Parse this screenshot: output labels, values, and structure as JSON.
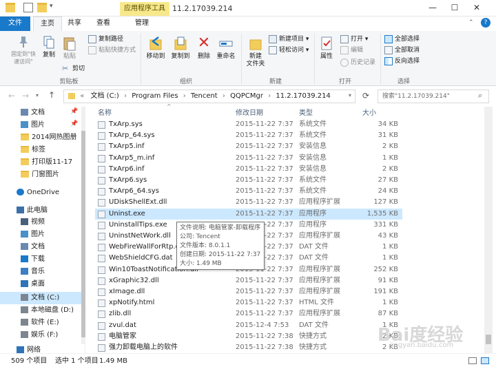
{
  "window": {
    "title": "11.2.17039.214",
    "context_tab": "应用程序工具",
    "controls": {
      "minimize": "—",
      "maximize": "☐",
      "close": "✕"
    }
  },
  "ribbon_tabs": [
    "文件",
    "主页",
    "共享",
    "查看",
    "管理"
  ],
  "ribbon": {
    "clipboard": {
      "pin": "固定到\"快\n速访问\"",
      "copy": "复制",
      "paste": "粘贴",
      "copy_path": "复制路径",
      "paste_shortcut": "粘贴快捷方式",
      "cut": "剪切",
      "label": "剪贴板"
    },
    "organize": {
      "move_to": "移动到",
      "copy_to": "复制到",
      "delete": "删除",
      "rename": "重命名",
      "label": "组织"
    },
    "new": {
      "new_folder": "新建\n文件夹",
      "new_item": "新建项目",
      "easy_access": "轻松访问",
      "label": "新建"
    },
    "open": {
      "properties": "属性",
      "open": "打开",
      "edit": "编辑",
      "history": "历史记录",
      "label": "打开"
    },
    "select": {
      "select_all": "全部选择",
      "select_none": "全部取消",
      "invert": "反向选择",
      "label": "选择"
    }
  },
  "address": {
    "crumbs": [
      "文档 (C:)",
      "Program Files",
      "Tencent",
      "QQPCMgr",
      "11.2.17039.214"
    ],
    "search_placeholder": "搜索\"11.2.17039.214\""
  },
  "nav": [
    {
      "label": "文档",
      "kind": "doc"
    },
    {
      "label": "图片",
      "kind": "pic"
    },
    {
      "label": "2014网热图册",
      "kind": "folder"
    },
    {
      "label": "标签",
      "kind": "folder"
    },
    {
      "label": "打印版11-17",
      "kind": "folder"
    },
    {
      "label": "门窗图片",
      "kind": "folder"
    },
    {
      "label": "OneDrive",
      "kind": "cloud"
    },
    {
      "label": "此电脑",
      "kind": "pc"
    },
    {
      "label": "视频",
      "kind": "video"
    },
    {
      "label": "图片",
      "kind": "pic"
    },
    {
      "label": "文档",
      "kind": "doc"
    },
    {
      "label": "下载",
      "kind": "down"
    },
    {
      "label": "音乐",
      "kind": "music"
    },
    {
      "label": "桌面",
      "kind": "desk"
    },
    {
      "label": "文档 (C:)",
      "kind": "drive"
    },
    {
      "label": "本地磁盘 (D:)",
      "kind": "drive"
    },
    {
      "label": "软件 (E:)",
      "kind": "drive"
    },
    {
      "label": "娱乐 (F:)",
      "kind": "drive"
    },
    {
      "label": "网络",
      "kind": "net"
    }
  ],
  "columns": {
    "name": "名称",
    "date": "修改日期",
    "type": "类型",
    "size": "大小"
  },
  "files": [
    {
      "name": "TxArp.sys",
      "date": "2015-11-22 7:37",
      "type": "系统文件",
      "size": "34 KB"
    },
    {
      "name": "TxArp_64.sys",
      "date": "2015-11-22 7:37",
      "type": "系统文件",
      "size": "31 KB"
    },
    {
      "name": "TxArp5.inf",
      "date": "2015-11-22 7:37",
      "type": "安装信息",
      "size": "2 KB"
    },
    {
      "name": "TxArp5_m.inf",
      "date": "2015-11-22 7:37",
      "type": "安装信息",
      "size": "1 KB"
    },
    {
      "name": "TxArp6.inf",
      "date": "2015-11-22 7:37",
      "type": "安装信息",
      "size": "2 KB"
    },
    {
      "name": "TxArp6.sys",
      "date": "2015-11-22 7:37",
      "type": "系统文件",
      "size": "27 KB"
    },
    {
      "name": "TxArp6_64.sys",
      "date": "2015-11-22 7:37",
      "type": "系统文件",
      "size": "24 KB"
    },
    {
      "name": "UDiskShellExt.dll",
      "date": "2015-11-22 7:37",
      "type": "应用程序扩展",
      "size": "127 KB"
    },
    {
      "name": "Uninst.exe",
      "date": "2015-11-22 7:37",
      "type": "应用程序",
      "size": "1,535 KB",
      "selected": true
    },
    {
      "name": "UninstallTips.exe",
      "date": "2015-11-22 7:37",
      "type": "应用程序",
      "size": "331 KB"
    },
    {
      "name": "UninstNetWork.dll",
      "date": "2015-11-22 7:37",
      "type": "应用程序扩展",
      "size": "43 KB"
    },
    {
      "name": "WebFireWallForRtp.dat",
      "date": "2015-11-22 7:37",
      "type": "DAT 文件",
      "size": "1 KB"
    },
    {
      "name": "WebShieldCFG.dat",
      "date": "2015-11-22 7:37",
      "type": "DAT 文件",
      "size": "1 KB"
    },
    {
      "name": "Win10ToastNotification.dll",
      "date": "2015-11-22 7:37",
      "type": "应用程序扩展",
      "size": "252 KB"
    },
    {
      "name": "xGraphic32.dll",
      "date": "2015-11-22 7:37",
      "type": "应用程序扩展",
      "size": "91 KB"
    },
    {
      "name": "xImage.dll",
      "date": "2015-11-22 7:37",
      "type": "应用程序扩展",
      "size": "191 KB"
    },
    {
      "name": "xpNotify.html",
      "date": "2015-11-22 7:37",
      "type": "HTML 文件",
      "size": "1 KB"
    },
    {
      "name": "zlib.dll",
      "date": "2015-11-22 7:37",
      "type": "应用程序扩展",
      "size": "87 KB"
    },
    {
      "name": "zvul.dat",
      "date": "2015-12-4 7:53",
      "type": "DAT 文件",
      "size": "1 KB"
    },
    {
      "name": "电脑管家",
      "date": "2015-11-22 7:38",
      "type": "快捷方式",
      "size": "2 KB"
    },
    {
      "name": "强力卸载电脑上的软件",
      "date": "2015-11-22 7:38",
      "type": "快捷方式",
      "size": "2 KB"
    }
  ],
  "tooltip": [
    "文件说明: 电脑管家-卸载程序",
    "公司: Tencent",
    "文件版本: 8.0.1.1",
    "创建日期: 2015-11-22 7:37",
    "大小: 1.49 MB"
  ],
  "status": {
    "count": "509 个项目",
    "selected": "选中 1 个项目",
    "size": "1.49 MB"
  },
  "watermark": {
    "main": "Bai度经验",
    "sub": "jingyan.baidu.com"
  },
  "colors": {
    "accent": "#1979ca",
    "selection": "#cce8ff",
    "context_tab": "#f7e98b"
  }
}
